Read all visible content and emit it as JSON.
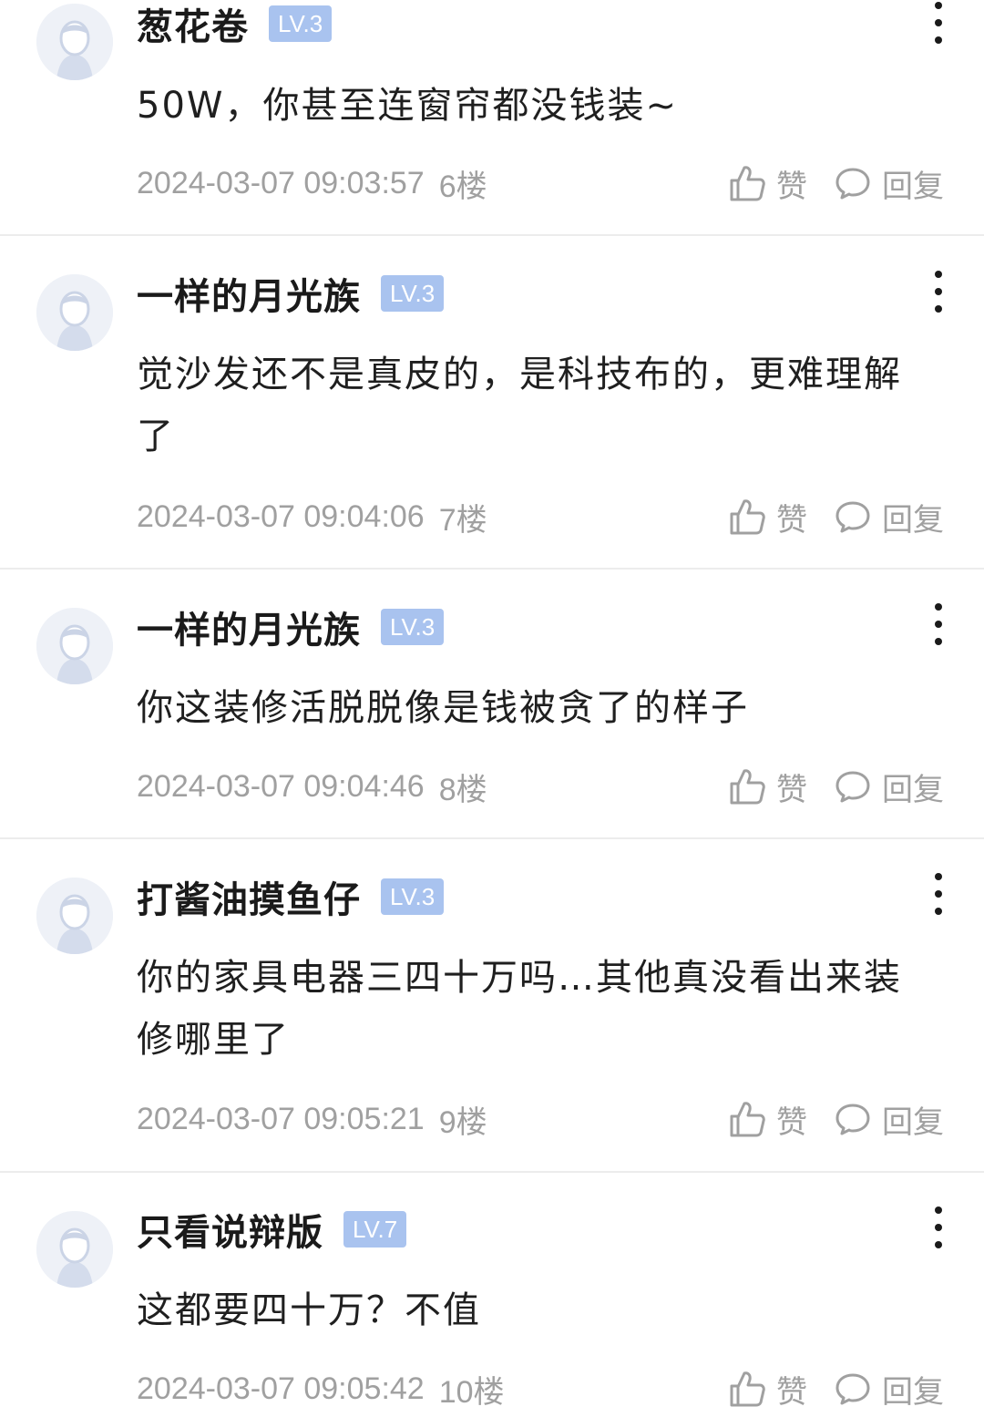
{
  "comments": [
    {
      "username": "葱花卷",
      "level": "LV.3",
      "content": "50W，你甚至连窗帘都没钱装~",
      "timestamp": "2024-03-07 09:03:57",
      "floor": "6楼",
      "like_label": "赞",
      "reply_label": "回复"
    },
    {
      "username": "一样的月光族",
      "level": "LV.3",
      "content": "觉沙发还不是真皮的，是科技布的，更难理解了",
      "timestamp": "2024-03-07 09:04:06",
      "floor": "7楼",
      "like_label": "赞",
      "reply_label": "回复"
    },
    {
      "username": "一样的月光族",
      "level": "LV.3",
      "content": "你这装修活脱脱像是钱被贪了的样子",
      "timestamp": "2024-03-07 09:04:46",
      "floor": "8楼",
      "like_label": "赞",
      "reply_label": "回复"
    },
    {
      "username": "打酱油摸鱼仔",
      "level": "LV.3",
      "content": "你的家具电器三四十万吗…其他真没看出来装修哪里了",
      "timestamp": "2024-03-07 09:05:21",
      "floor": "9楼",
      "like_label": "赞",
      "reply_label": "回复"
    },
    {
      "username": "只看说辩版",
      "level": "LV.7",
      "content": "这都要四十万？不值",
      "timestamp": "2024-03-07 09:05:42",
      "floor": "10楼",
      "like_label": "赞",
      "reply_label": "回复"
    }
  ],
  "icons": {
    "more": "more-vertical-icon",
    "like": "thumbs-up-icon",
    "reply": "speech-bubble-icon",
    "avatar": "default-avatar-icon"
  },
  "colors": {
    "level_badge": "#a9c3ef",
    "meta_text": "#a0a0a0",
    "divider": "#ececec"
  }
}
